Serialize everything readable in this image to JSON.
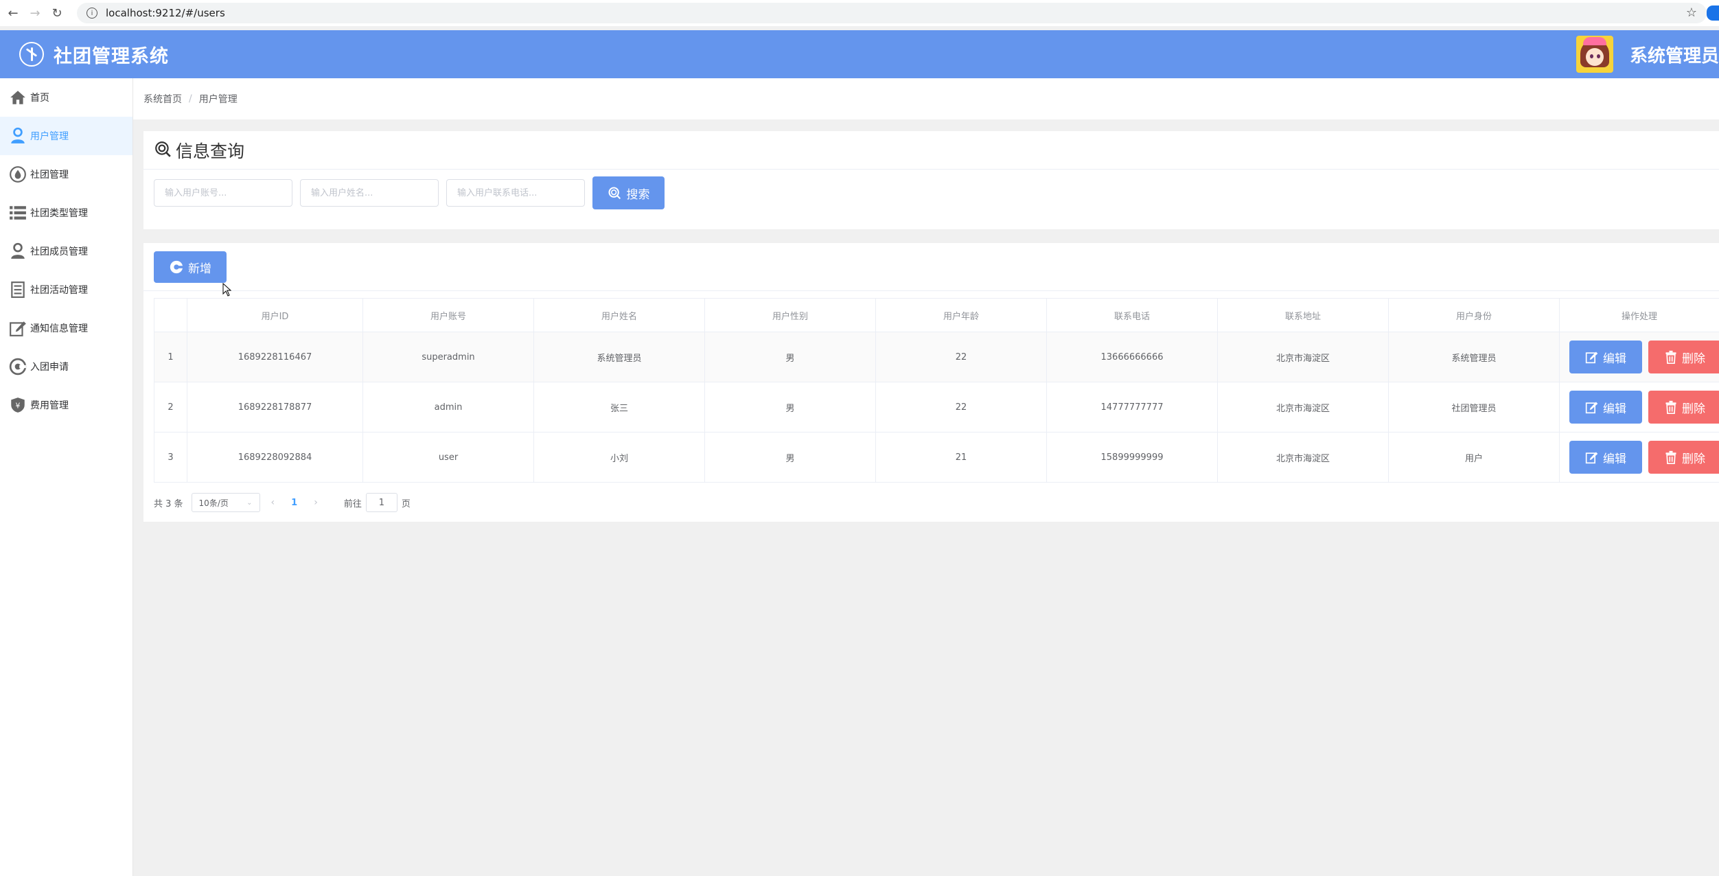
{
  "browser": {
    "url": "localhost:9212/#/users"
  },
  "header": {
    "app_title": "社团管理系统",
    "admin_name": "系统管理员"
  },
  "sidebar": {
    "items": [
      {
        "label": "首页",
        "icon": "home-icon"
      },
      {
        "label": "用户管理",
        "icon": "user-icon",
        "active": true
      },
      {
        "label": "社团管理",
        "icon": "drop-icon"
      },
      {
        "label": "社团类型管理",
        "icon": "list-icon"
      },
      {
        "label": "社团成员管理",
        "icon": "member-icon"
      },
      {
        "label": "社团活动管理",
        "icon": "document-icon"
      },
      {
        "label": "通知信息管理",
        "icon": "edit-icon"
      },
      {
        "label": "入团申请",
        "icon": "target-icon"
      },
      {
        "label": "费用管理",
        "icon": "money-icon"
      }
    ]
  },
  "breadcrumb": {
    "home": "系统首页",
    "current": "用户管理"
  },
  "search": {
    "title": "信息查询",
    "account_placeholder": "输入用户账号...",
    "name_placeholder": "输入用户姓名...",
    "phone_placeholder": "输入用户联系电话...",
    "search_label": "搜索"
  },
  "toolbar": {
    "add_label": "新增"
  },
  "table": {
    "columns": [
      "",
      "用户ID",
      "用户账号",
      "用户姓名",
      "用户性别",
      "用户年龄",
      "联系电话",
      "联系地址",
      "用户身份",
      "操作处理"
    ],
    "edit_label": "编辑",
    "delete_label": "删除",
    "rows": [
      {
        "index": "1",
        "id": "1689228116467",
        "account": "superadmin",
        "name": "系统管理员",
        "gender": "男",
        "age": "22",
        "phone": "13666666666",
        "address": "北京市海淀区",
        "role": "系统管理员"
      },
      {
        "index": "2",
        "id": "1689228178877",
        "account": "admin",
        "name": "张三",
        "gender": "男",
        "age": "22",
        "phone": "14777777777",
        "address": "北京市海淀区",
        "role": "社团管理员"
      },
      {
        "index": "3",
        "id": "1689228092884",
        "account": "user",
        "name": "小刘",
        "gender": "男",
        "age": "21",
        "phone": "15899999999",
        "address": "北京市海淀区",
        "role": "用户"
      }
    ]
  },
  "pagination": {
    "total": "共 3 条",
    "page_size": "10条/页",
    "current_page": "1",
    "goto_label": "前往",
    "goto_value": "1",
    "page_suffix": "页"
  },
  "colors": {
    "primary": "#6495ed",
    "danger": "#f56c6c",
    "active_text": "#409eff"
  }
}
